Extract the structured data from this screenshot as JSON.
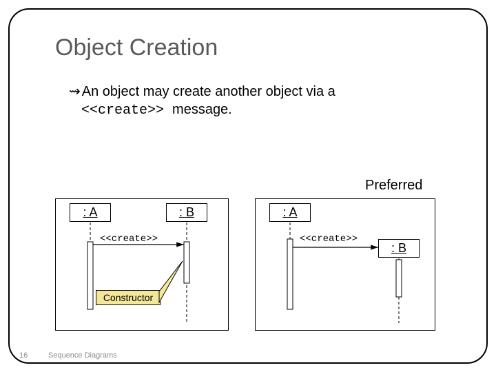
{
  "title": "Object Creation",
  "bullet_prefix": "An object may create another object via a",
  "bullet_code": "<<create>> ",
  "bullet_suffix": "message.",
  "preferred_label": "Preferred",
  "objA": ": A",
  "objB": ": B",
  "msg_create": "<<create>>",
  "note_constructor": "Constructor",
  "footer_page": "16",
  "footer_caption": "Sequence Diagrams"
}
